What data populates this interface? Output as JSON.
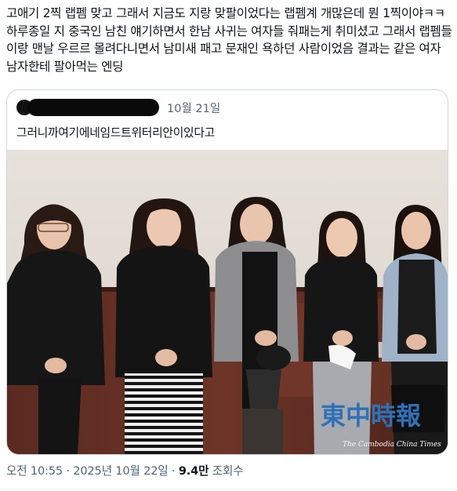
{
  "tweet": {
    "text": "고애기 2찍 랩펨 맞고 그래서 지금도 지랑 맞팔이었다는 랩펨계 개많은데 뭔 1찍이야ㅋㅋ 하루종일 지 중국인 남친 얘기하면서 한남 사귀는 여자들 줘패는게 취미셨고 그래서 랩펨들이랑 맨날 우르르 몰려다니면서 남미새 패고 문재인 욕하던 사람이었음 결과는 같은 여자 남자한테 팔아먹는 엔딩"
  },
  "quote": {
    "date": "10월 21일",
    "text": "그러니까여기에네임드트위터리안이있다고",
    "media": {
      "watermark_cn": "東中時報",
      "watermark_en": "The Cambodia China Times"
    }
  },
  "meta": {
    "time_date": "오전 10:55 · 2025년 10월 22일 · ",
    "views_count": "9.4만",
    "views_label": " 조회수"
  }
}
